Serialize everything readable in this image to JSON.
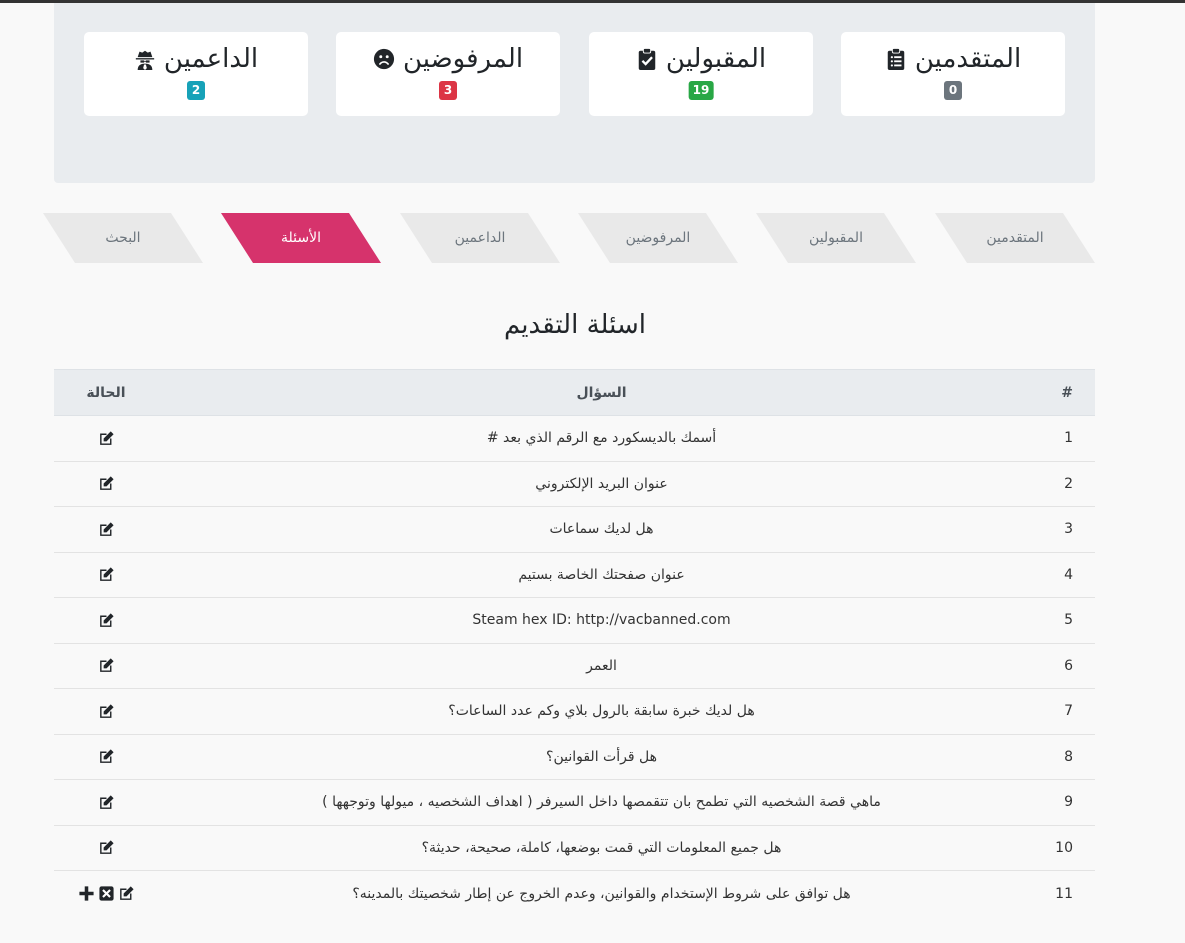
{
  "stats": [
    {
      "label": "المتقدمين",
      "count": "0",
      "icon": "clipboard-list-icon",
      "color": "#6c757d"
    },
    {
      "label": "المقبولين",
      "count": "19",
      "icon": "clipboard-check-icon",
      "color": "#28a745"
    },
    {
      "label": "المرفوضين",
      "count": "3",
      "icon": "sad-face-icon",
      "color": "#dc3545"
    },
    {
      "label": "الداعمين",
      "count": "2",
      "icon": "spy-icon",
      "color": "#17a2b8"
    }
  ],
  "tabs": [
    {
      "label": "المتقدمين",
      "active": false
    },
    {
      "label": "المقبولين",
      "active": false
    },
    {
      "label": "المرفوضين",
      "active": false
    },
    {
      "label": "الداعمين",
      "active": false
    },
    {
      "label": "الأسئلة",
      "active": true
    },
    {
      "label": "البحث",
      "active": false
    }
  ],
  "section_title": "اسئلة التقديم",
  "table": {
    "headers": {
      "num": "#",
      "question": "السؤال",
      "status": "الحالة"
    },
    "rows": [
      {
        "num": "1",
        "question": "أسمك بالديسكورد مع الرقم الذي بعد #"
      },
      {
        "num": "2",
        "question": "عنوان البريد الإلكتروني"
      },
      {
        "num": "3",
        "question": "هل لديك سماعات"
      },
      {
        "num": "4",
        "question": "عنوان صفحتك الخاصة بستيم"
      },
      {
        "num": "5",
        "question": "Steam hex ID: http://vacbanned.com"
      },
      {
        "num": "6",
        "question": "العمر"
      },
      {
        "num": "7",
        "question": "هل لديك خبرة سابقة بالرول بلاي وكم عدد الساعات؟"
      },
      {
        "num": "8",
        "question": "هل قرأت القوانين؟"
      },
      {
        "num": "9",
        "question": "ماهي قصة الشخصيه التي تطمح بان تتقمصها داخل السيرفر ( اهداف الشخصيه ، ميولها وتوجهها )"
      },
      {
        "num": "10",
        "question": "هل جميع المعلومات التي قمت بوضعها، كاملة، صحيحة، حديثة؟"
      },
      {
        "num": "11",
        "question": "هل توافق على شروط الإستخدام والقوانين، وعدم الخروج عن إطار شخصيتك بالمدينه؟"
      }
    ]
  }
}
